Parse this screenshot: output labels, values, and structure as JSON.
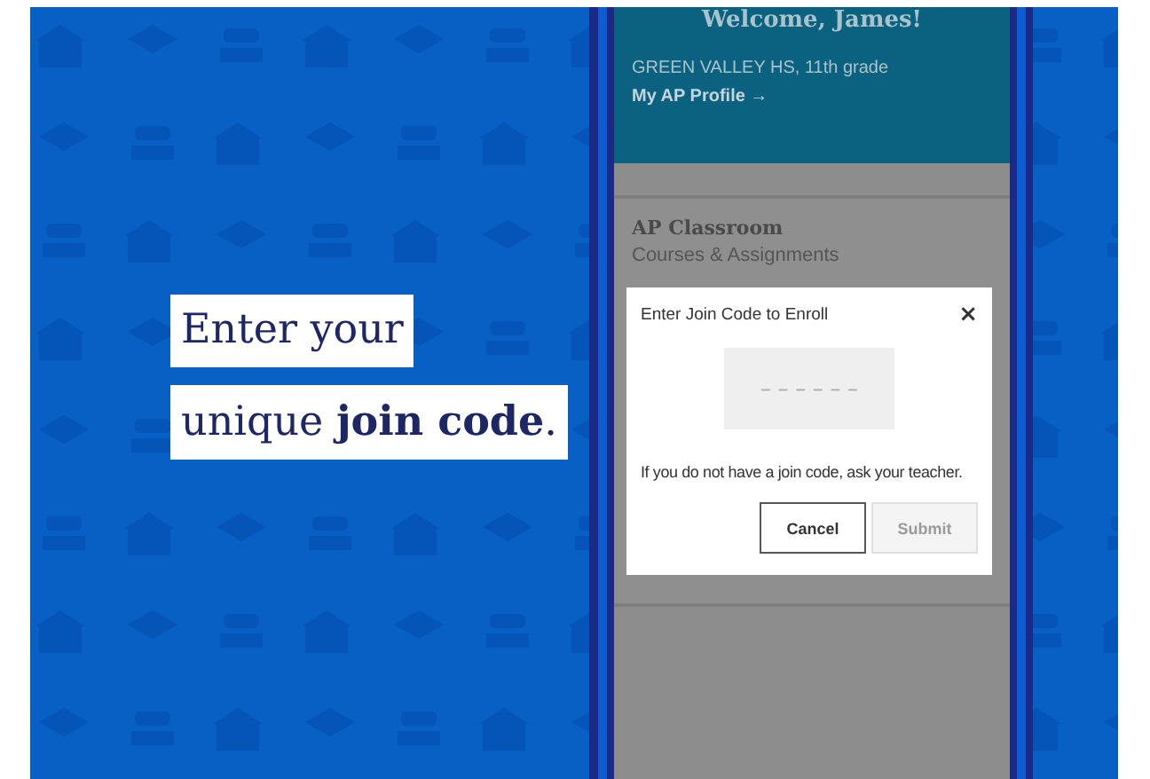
{
  "slide": {
    "lines": [
      "Enter your",
      "unique **join code**."
    ]
  },
  "app": {
    "header": {
      "title": "Welcome, James!",
      "school": "GREEN VALLEY HS, 11th grade",
      "profile_link": "My AP Profile →"
    },
    "card": {
      "title": "AP Classroom",
      "subtitle": "Courses & Assignments"
    }
  },
  "dialog": {
    "title": "Enter Join Code to Enroll",
    "close": "×",
    "code_field": {
      "placeholder": "– – – – – –"
    },
    "hint": "If you do not have a join code, ask your teacher.",
    "buttons": [
      {
        "label": "Cancel",
        "disabled": false
      },
      {
        "label": "Submit",
        "disabled": true
      }
    ]
  }
}
